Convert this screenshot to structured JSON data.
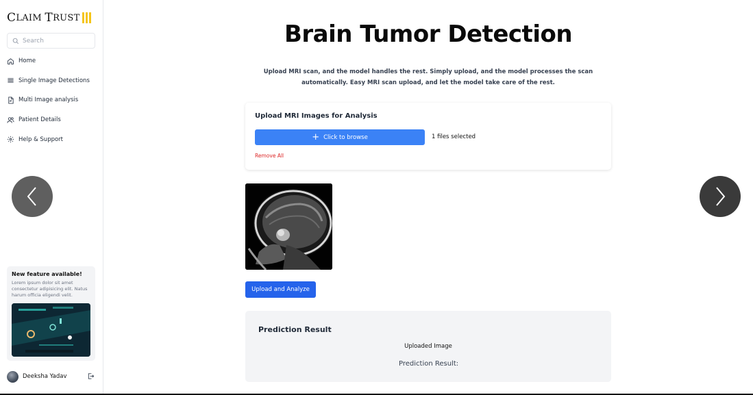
{
  "brand": {
    "name_first": "C",
    "name_rest": "LAIM ",
    "name_second_first": "T",
    "name_second_rest": "RUST",
    "accent_color": "#f5c518"
  },
  "search": {
    "placeholder": "Search",
    "icon": "search-icon"
  },
  "nav": [
    {
      "label": "Home",
      "icon": "home-icon"
    },
    {
      "label": "Single Image Detections",
      "icon": "list-icon"
    },
    {
      "label": "Multi Image analysis",
      "icon": "document-icon"
    },
    {
      "label": "Patient Details",
      "icon": "users-icon"
    },
    {
      "label": "Help & Support",
      "icon": "gear-icon"
    }
  ],
  "promo": {
    "title": "New feature available!",
    "text": "Lorem ipsum dolor sit amet consectetur adipisicing elit. Natus harum officia eligendi velit."
  },
  "user": {
    "name": "Deeksha Yadav"
  },
  "main": {
    "title": "Brain Tumor Detection",
    "subtitle": "Upload MRI scan, and the model handles the rest. Simply upload, and the model processes the scan automatically. Easy MRI scan upload, and let the model take care of the rest."
  },
  "upload_card": {
    "title": "Upload MRI Images for Analysis",
    "browse_label": "Click to browse",
    "files_selected": "1 files selected",
    "remove_all": "Remove All"
  },
  "analyze_button": "Upload and Analyze",
  "result": {
    "title": "Prediction Result",
    "uploaded_label": "Uploaded Image",
    "prediction_label": "Prediction Result:"
  },
  "colors": {
    "primary": "#3b82f6",
    "primary_dark": "#2563eb",
    "danger": "#dc2626"
  }
}
